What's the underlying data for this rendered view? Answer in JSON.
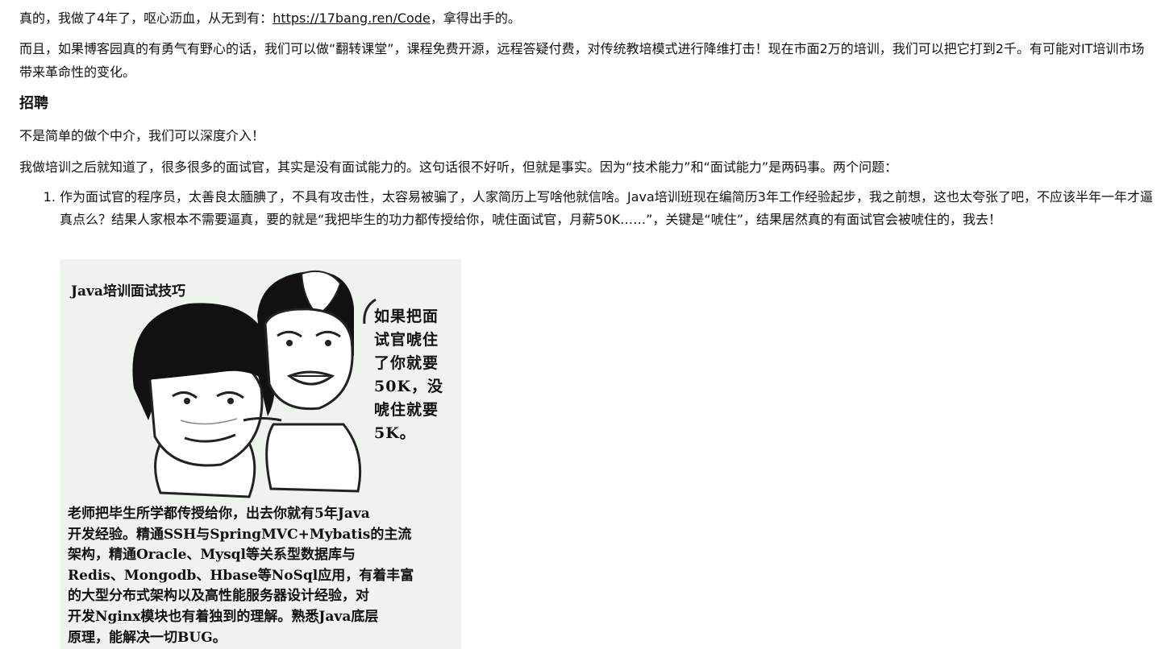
{
  "intro": {
    "text_before_link": "真的，我做了4年了，呕心沥血，从无到有：",
    "link": "https://17bang.ren/Code",
    "text_after_link": "，拿得出手的。"
  },
  "flip_paragraph": "而且，如果博客园真的有勇气有野心的话，我们可以做“翻转课堂”，课程免费开源，远程答疑付费，对传统教培模式进行降维打击！现在市面2万的培训，我们可以把它打到2千。有可能对IT培训市场带来革命性的变化。",
  "recruit": {
    "heading": "招聘",
    "p1": "不是简单的做个中介，我们可以深度介入！",
    "p2": "我做培训之后就知道了，很多很多的面试官，其实是没有面试能力的。这句话很不好听，但就是事实。因为“技术能力”和“面试能力”是两码事。两个问题：",
    "list": [
      "作为面试官的程序员，太善良太腼腆了，不具有攻击性，太容易被骗了，人家简历上写啥他就信啥。Java培训班现在编简历3年工作经验起步，我之前想，这也太夸张了吧，不应该半年一年才逼真点么？结果人家根本不需要逼真，要的就是“我把毕生的功力都传授给你，唬住面试官，月薪50K……”，关键是“唬住”，结果居然真的有面试官会被唬住的，我去！"
    ]
  },
  "meme": {
    "title": "Java培训面试技巧",
    "speech": [
      "如果把面",
      "试官唬住",
      "了你就要",
      "50K，没",
      "唬住就要",
      "5K。"
    ],
    "caption": [
      "老师把毕生所学都传授给你，出去你就有5年Java",
      "开发经验。精通SSH与SpringMVC+Mybatis的主流",
      "架构，精通Oracle、Mysql等关系型数据库与",
      "Redis、Mongodb、Hbase等NoSql应用，有着丰富",
      "的大型分布式架构以及高性能服务器设计经验，对",
      "开发Nginx模块也有着独到的理解。熟悉Java底层",
      "原理，能解决一切BUG。"
    ]
  }
}
